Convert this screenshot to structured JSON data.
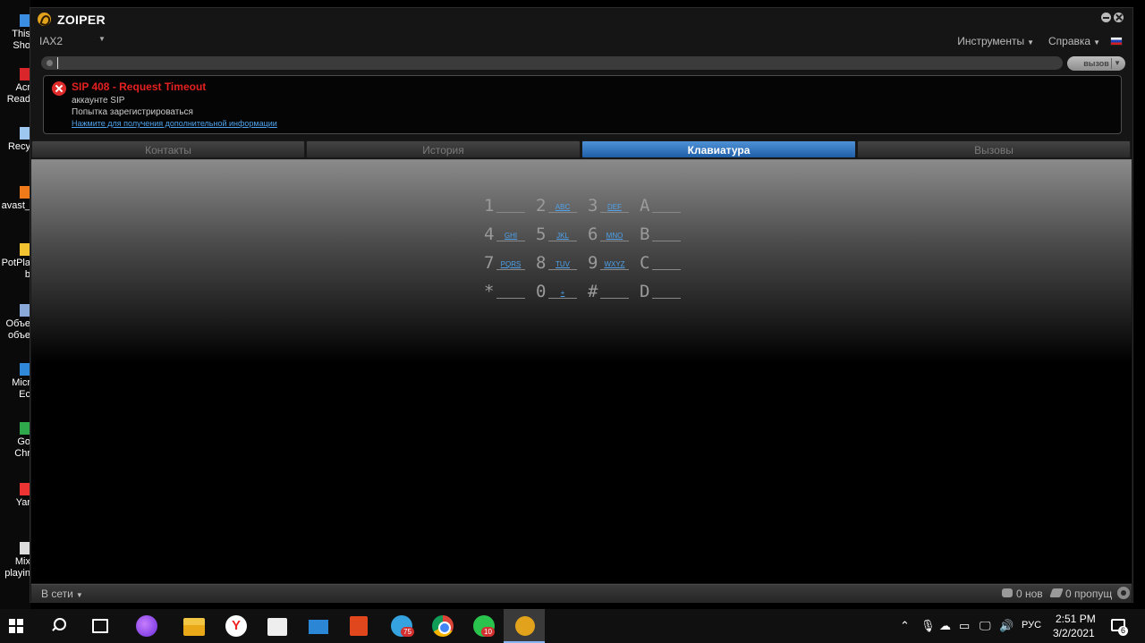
{
  "desktop": {
    "items": [
      {
        "label": "This\nSho",
        "color": "#3a8de0"
      },
      {
        "label": "Acr\nRead",
        "color": "#d8262b"
      },
      {
        "label": "Recy",
        "color": "#9ec7f0"
      },
      {
        "label": "avast_",
        "color": "#f07a1a"
      },
      {
        "label": "PotPla\nb",
        "color": "#f2c230"
      },
      {
        "label": "Объе\nобъе",
        "color": "#8aa8d8"
      },
      {
        "label": "Micr\nEc",
        "color": "#2f88d8"
      },
      {
        "label": "Go\nChr",
        "color": "#2ea84a"
      },
      {
        "label": "Yar",
        "color": "#e33"
      },
      {
        "label": "Mix\nplayin",
        "color": "#ddd"
      }
    ]
  },
  "window": {
    "title": "ZOIPER",
    "account": "IAX2",
    "menu_tools": "Инструменты",
    "menu_help": "Справка",
    "dial_input_value": "",
    "call_button_label": "вызов"
  },
  "error": {
    "title": "SIP 408 - Request Timeout",
    "line1": "аккаунте SIP",
    "line2": "Попытка зарегистрироваться",
    "link": "Нажмите для получения дополнительной информации"
  },
  "tabs": [
    {
      "label": "Контакты",
      "active": false
    },
    {
      "label": "История",
      "active": false
    },
    {
      "label": "Клавиатура",
      "active": true
    },
    {
      "label": "Вызовы",
      "active": false
    }
  ],
  "keypad": [
    [
      {
        "digit": "1",
        "letters": ""
      },
      {
        "digit": "2",
        "letters": "ABC"
      },
      {
        "digit": "3",
        "letters": "DEF"
      },
      {
        "digit": "A",
        "letters": ""
      }
    ],
    [
      {
        "digit": "4",
        "letters": "GHI"
      },
      {
        "digit": "5",
        "letters": "JKL"
      },
      {
        "digit": "6",
        "letters": "MNO"
      },
      {
        "digit": "B",
        "letters": ""
      }
    ],
    [
      {
        "digit": "7",
        "letters": "PQRS"
      },
      {
        "digit": "8",
        "letters": "TUV"
      },
      {
        "digit": "9",
        "letters": "WXYZ"
      },
      {
        "digit": "C",
        "letters": ""
      }
    ],
    [
      {
        "digit": "*",
        "letters": ""
      },
      {
        "digit": "0",
        "letters": "+"
      },
      {
        "digit": "#",
        "letters": ""
      },
      {
        "digit": "D",
        "letters": ""
      }
    ]
  ],
  "status": {
    "online": "В сети",
    "new": "0 нов",
    "missed": "0 пропущ"
  },
  "taskbar": {
    "telegram_badge": "75",
    "whatsapp_badge": "10",
    "language": "РУС",
    "time": "2:51 PM",
    "date": "3/2/2021",
    "notifications": "6"
  }
}
